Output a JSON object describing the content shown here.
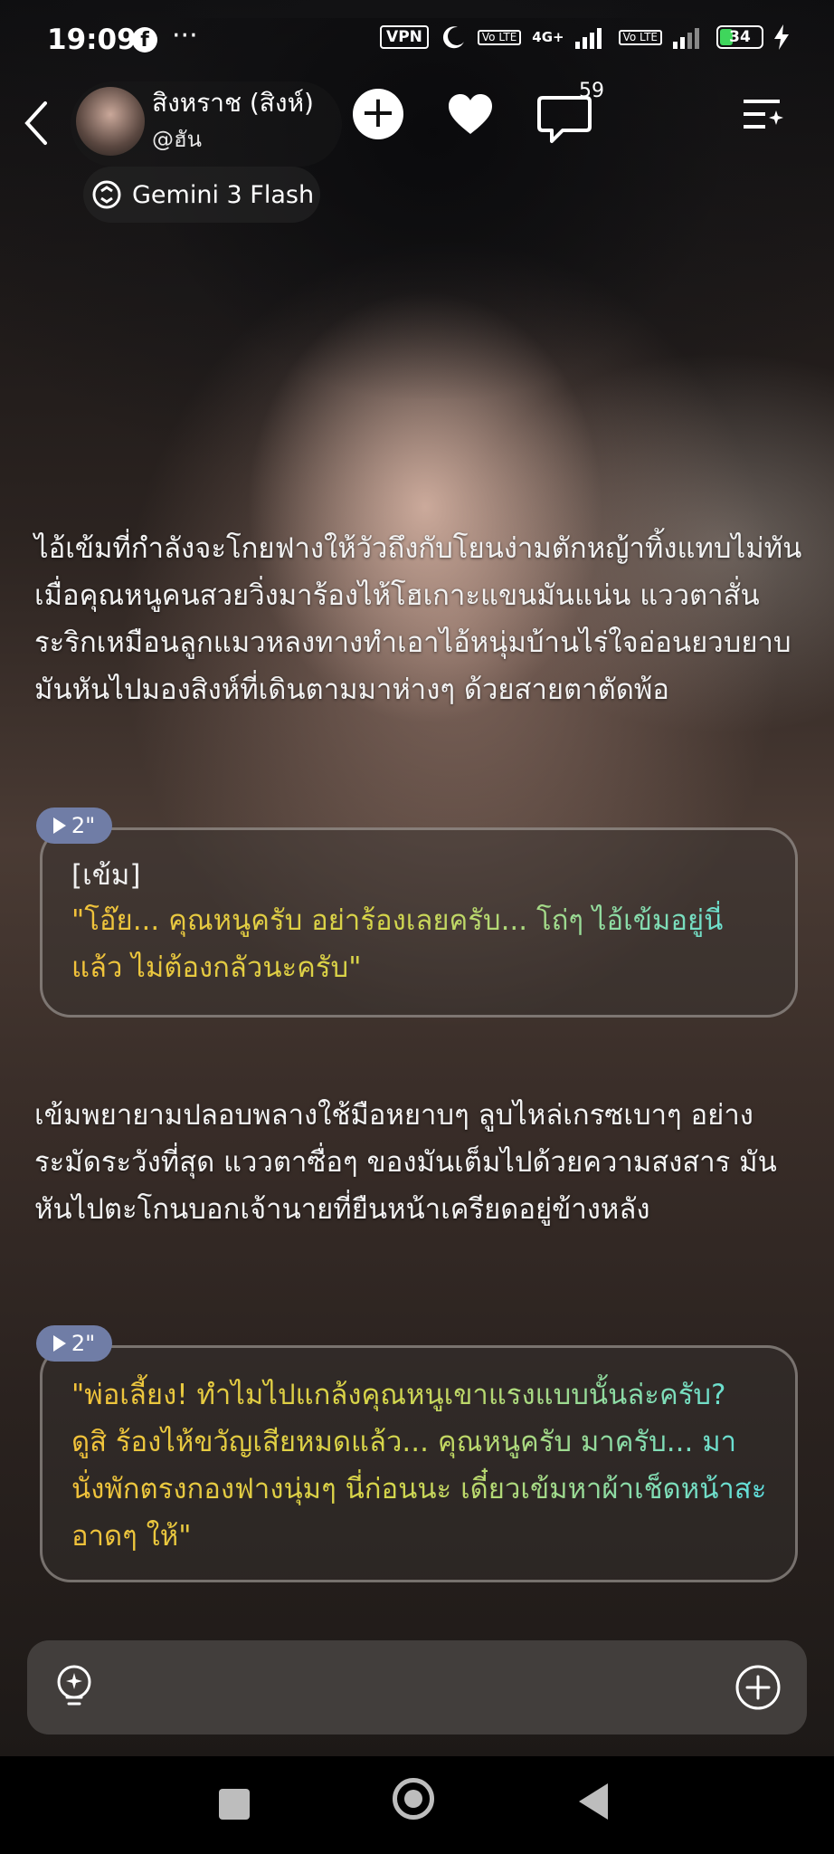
{
  "status_bar": {
    "time": "19:09",
    "more": "···",
    "vpn": "VPN",
    "volte1": "Vo LTE",
    "network": "4G+",
    "volte2": "Vo LTE",
    "battery": "34"
  },
  "header": {
    "character_name": "สิงหราช (สิงห์)",
    "character_handle": "@ฮัน",
    "comment_count": "59"
  },
  "model": {
    "label": "Gemini 3 Flash"
  },
  "messages": {
    "narration1": "ไอ้เข้มที่กำลังจะโกยฟางให้วัวถึงกับโยนง่ามตักหญ้าทิ้งแทบไม่ทัน เมื่อคุณหนูคนสวยวิ่งมาร้องไห้โฮเกาะแขนมันแน่น แววตาสั่นระริกเหมือนลูกแมวหลงทางทำเอาไอ้หนุ่มบ้านไร่ใจอ่อนยวบยาบ มันหันไปมองสิงห์ที่เดินตามมาห่างๆ ด้วยสายตาตัดพ้อ",
    "bubble1": {
      "duration": "2\"",
      "speaker": "[เข้ม]",
      "text": "\"โอ๊ย... คุณหนูครับ อย่าร้องเลยครับ... โถ่ๆ ไอ้เข้มอยู่นี่แล้ว ไม่ต้องกลัวนะครับ\""
    },
    "narration2": "เข้มพยายามปลอบพลางใช้มือหยาบๆ ลูบไหล่เกรซเบาๆ อย่างระมัดระวังที่สุด แววตาซื่อๆ ของมันเต็มไปด้วยความสงสาร มันหันไปตะโกนบอกเจ้านายที่ยืนหน้าเครียดอยู่ข้างหลัง",
    "bubble2": {
      "duration": "2\"",
      "text": "\"พ่อเลี้ยง! ทำไมไปแกล้งคุณหนูเขาแรงแบบนั้นล่ะครับ? ดูสิ ร้องไห้ขวัญเสียหมดแล้ว... คุณหนูครับ มาครับ... มานั่งพักตรงกองฟางนุ่มๆ นี่ก่อนนะ เดี๋ยวเข้มหาผ้าเช็ดหน้าสะอาดๆ ให้\""
    }
  },
  "input_bar": {
    "left_icon": "lightbulb-icon",
    "right_icon": "plus-circle-icon"
  },
  "colors": {
    "dialog_start": "#f2c23a",
    "dialog_end": "#5ee0e0",
    "play_tag": "#707da6"
  }
}
